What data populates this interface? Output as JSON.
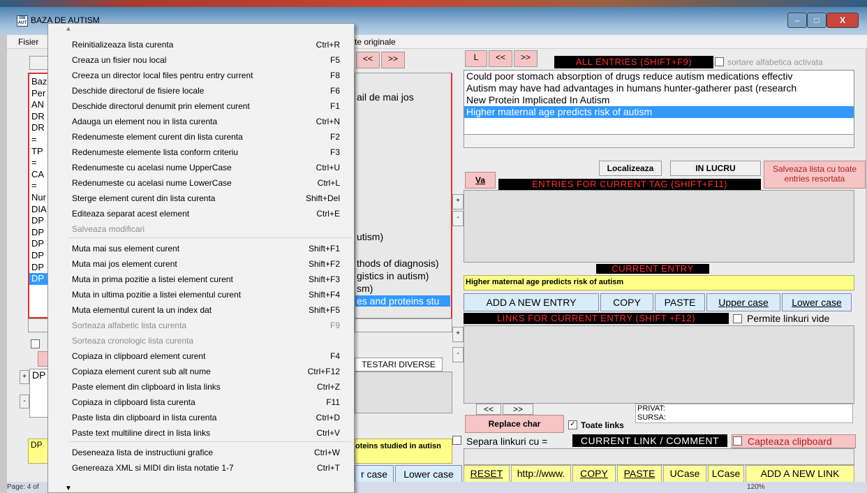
{
  "window": {
    "title": "BAZA DE AUTISM",
    "icon": "DB\nAUT"
  },
  "menubar": {
    "fisier": "Fisier",
    "originale": "te originale"
  },
  "nav": {
    "prev": "<<",
    "next": ">>",
    "l": "L"
  },
  "left_list": {
    "items": [
      "Baz",
      "Per",
      "AN",
      "DR",
      "DR",
      "=",
      "TP",
      "=",
      "CA",
      "=",
      "Nur",
      "DIA",
      "DP",
      "DP",
      "DP",
      "DP",
      "DP",
      "DP"
    ],
    "selected_index": 17
  },
  "middle": {
    "text1": "ail de mai jos",
    "items": [
      "utism)",
      "thods of diagnosis)",
      "gistics in autism)",
      "sm)",
      "es and proteins stu"
    ],
    "testari": "TESTARI DIVERSE",
    "bottom_yellow": "oteins studied in autisn",
    "btn_ucase": "r case",
    "btn_lcase": "Lower case",
    "dp1": "DP",
    "dp2": "DP"
  },
  "all_entries": {
    "title": "ALL ENTRIES (SHIFT+F9)",
    "sort_label": "sortare alfabetica activata",
    "items": [
      "Could poor stomach absorption of drugs reduce autism medications effectiv",
      "Autism may have had advantages in humans hunter-gatherer past (research",
      "New Protein Implicated In Autism",
      "Higher maternal age predicts risk of autism"
    ],
    "selected_index": 3
  },
  "tag": {
    "localizeaza": "Localizeaza",
    "in_lucru": "IN LUCRU",
    "salveaza": "Salveaza lista cu toate entries resortata",
    "va": "Va",
    "title": "ENTRIES FOR CURRENT TAG (SHIFT+F11)"
  },
  "current_entry": {
    "title": "CURRENT ENTRY",
    "value": "Higher maternal age predicts risk of autism",
    "add": "ADD A NEW ENTRY",
    "copy": "COPY",
    "paste": "PASTE",
    "upper": "Upper case",
    "lower": "Lower case"
  },
  "links": {
    "title": "LINKS FOR CURRENT ENTRY (SHIFT +F12)",
    "permite": "Permite linkuri vide",
    "privat": "PRIVAT:",
    "sursa": "SURSA:",
    "replace": "Replace char",
    "toate": "Toate links",
    "separa": "Separa linkuri cu =",
    "current_link": "CURRENT LINK / COMMENT",
    "capteaza": "Capteaza clipboard"
  },
  "bottom": {
    "reset": "RESET",
    "http": "http://www.",
    "copy": "COPY",
    "paste": "PASTE",
    "ucase": "UCase",
    "lcase": "LCase",
    "add": "ADD A NEW LINK"
  },
  "status": {
    "page": "Page: 4 of",
    "zoom": "120%"
  },
  "context_menu": {
    "items": [
      {
        "label": "Reinitializeaza lista curenta",
        "shortcut": "Ctrl+R",
        "disabled": false
      },
      {
        "label": "Creaza un fisier nou local",
        "shortcut": "F5",
        "disabled": false
      },
      {
        "label": "Creeza un director local files pentru entry current",
        "shortcut": "F8",
        "disabled": false
      },
      {
        "label": "Deschide directorul de fisiere locale",
        "shortcut": "F6",
        "disabled": false
      },
      {
        "label": "Deschide directorul denumit prin element curent",
        "shortcut": "F1",
        "disabled": false
      },
      {
        "label": "Adauga un element nou in lista curenta",
        "shortcut": "Ctrl+N",
        "disabled": false
      },
      {
        "label": "Redenumeste element curent din lista curenta",
        "shortcut": "F2",
        "disabled": false
      },
      {
        "label": "Redenumeste elemente lista conform criteriu",
        "shortcut": "F3",
        "disabled": false
      },
      {
        "label": "Redenumeste cu acelasi nume UpperCase",
        "shortcut": "Ctrl+U",
        "disabled": false
      },
      {
        "label": "Redenumeste cu acelasi nume LowerCase",
        "shortcut": "Ctrl+L",
        "disabled": false
      },
      {
        "label": "Sterge element curent din lista curenta",
        "shortcut": "Shift+Del",
        "disabled": false
      },
      {
        "label": "Editeaza separat acest element",
        "shortcut": "Ctrl+E",
        "disabled": false
      },
      {
        "label": "Salveaza modificari",
        "shortcut": "",
        "disabled": true
      },
      {
        "label": "Muta mai sus element curent",
        "shortcut": "Shift+F1",
        "disabled": false
      },
      {
        "label": "Muta mai jos element curent",
        "shortcut": "Shift+F2",
        "disabled": false
      },
      {
        "label": "Muta in prima pozitie a listei element curent",
        "shortcut": "Shift+F3",
        "disabled": false
      },
      {
        "label": "Muta in ultima pozitie a listei elementul curent",
        "shortcut": "Shift+F4",
        "disabled": false
      },
      {
        "label": "Muta elementul curent la un index dat",
        "shortcut": "Shift+F5",
        "disabled": false
      },
      {
        "label": "Sorteaza alfabetic lista curenta",
        "shortcut": "F9",
        "disabled": true
      },
      {
        "label": "Sorteaza cronologic lista curenta",
        "shortcut": "",
        "disabled": true
      },
      {
        "label": "Copiaza in clipboard element curent",
        "shortcut": "F4",
        "disabled": false
      },
      {
        "label": "Copiaza element curent sub alt nume",
        "shortcut": "Ctrl+F12",
        "disabled": false
      },
      {
        "label": "Paste element din clipboard in lista links",
        "shortcut": "Ctrl+Z",
        "disabled": false
      },
      {
        "label": "Copiaza in clipboard lista curenta",
        "shortcut": "F11",
        "disabled": false
      },
      {
        "label": "Paste lista din clipboard in lista curenta",
        "shortcut": "Ctrl+D",
        "disabled": false
      },
      {
        "label": "Paste text multiline direct in lista links",
        "shortcut": "Ctrl+V",
        "disabled": false
      },
      {
        "label": "Deseneaza lista de instructiuni grafice",
        "shortcut": "Ctrl+W",
        "disabled": false
      },
      {
        "label": "Genereaza XML si MIDI din lista notatie 1-7",
        "shortcut": "Ctrl+T",
        "disabled": false
      }
    ]
  },
  "colors": {
    "selection": "#3399ff",
    "pink": "#f6c4c4",
    "yellow": "#ffff88"
  }
}
